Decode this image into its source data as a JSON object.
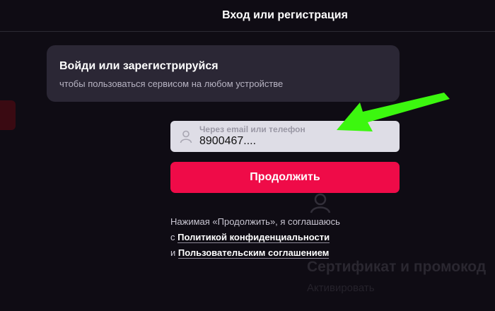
{
  "header": {
    "title": "Вход или регистрация"
  },
  "card": {
    "title": "Войди или зарегистрируйся",
    "subtitle": "чтобы пользоваться сервисом на любом устройстве"
  },
  "login_field": {
    "label": "Через email или телефон",
    "value": "8900467....",
    "icon": "user-icon"
  },
  "continue_button": {
    "label": "Продолжить"
  },
  "consent": {
    "line1": "Нажимая «Продолжить», я соглашаюсь",
    "prefix2": "с",
    "privacy_link": "Политикой конфиденциальности",
    "prefix3": "и",
    "terms_link": "Пользовательским соглашением"
  },
  "background": {
    "promo_title": "Сертификат и промокод",
    "promo_action": "Активировать"
  },
  "colors": {
    "accent": "#ef0b48",
    "annotation_arrow": "#3cf70f",
    "background": "#0f0c14"
  }
}
